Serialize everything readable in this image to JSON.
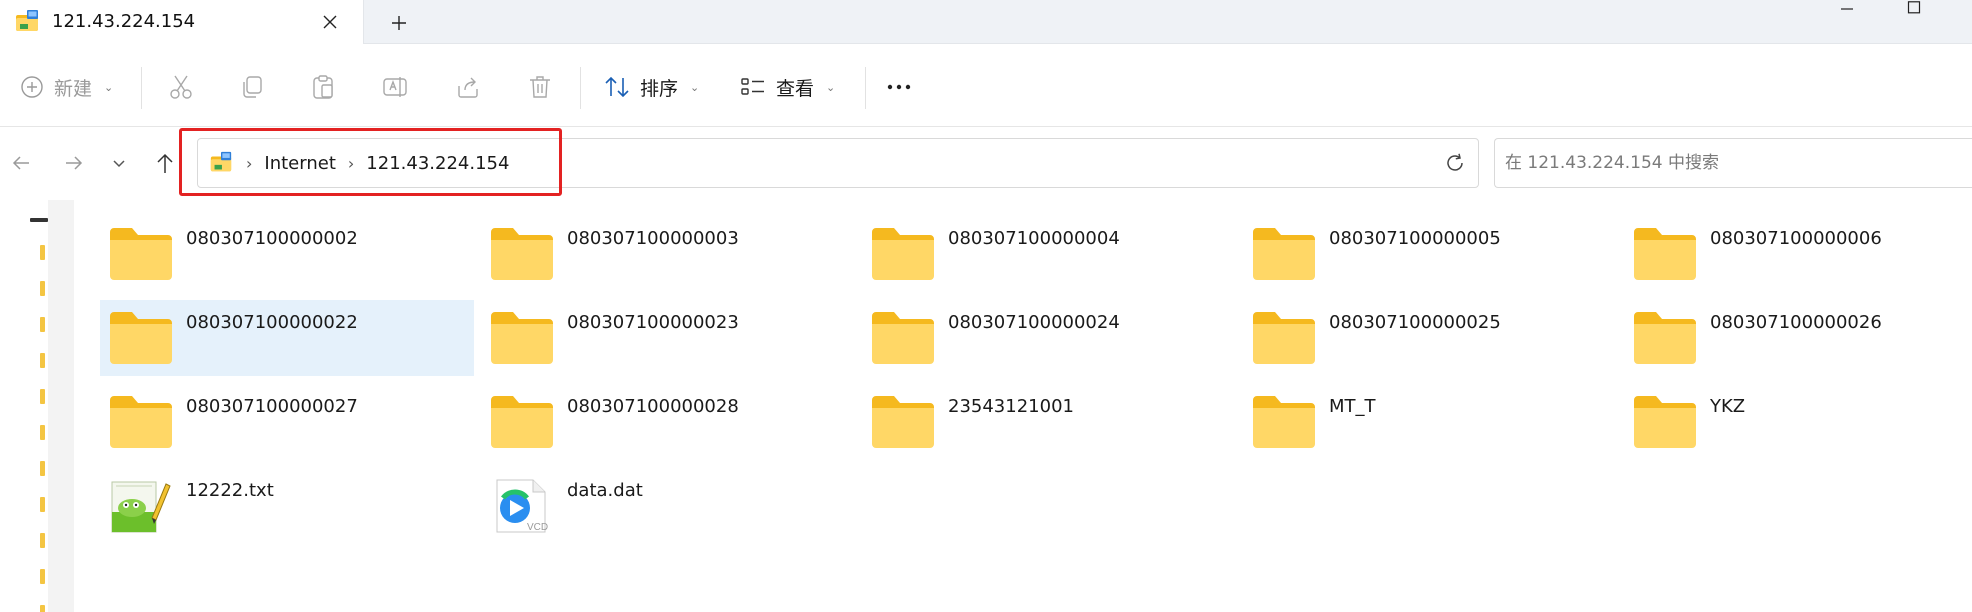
{
  "window": {
    "tab_title": "121.43.224.154",
    "tab_icon": "network-location-icon",
    "close_glyph": "✕",
    "new_tab_glyph": "+"
  },
  "toolbar": {
    "new_label": "新建",
    "sort_label": "排序",
    "view_label": "查看",
    "more_glyph": "•••",
    "disabled_icons": [
      "cut-icon",
      "copy-icon",
      "paste-icon",
      "rename-icon",
      "share-icon",
      "delete-icon"
    ]
  },
  "address": {
    "crumbs": [
      "Internet",
      "121.43.224.154"
    ],
    "separator": "›",
    "highlight_color": "#e32222"
  },
  "search": {
    "placeholder": "在 121.43.224.154 中搜索",
    "value": ""
  },
  "colors": {
    "folder_back": "#f5b91f",
    "folder_front": "#ffd766",
    "selection": "#e5f1fb"
  },
  "items": [
    {
      "name": "080307100000002",
      "type": "folder"
    },
    {
      "name": "080307100000003",
      "type": "folder"
    },
    {
      "name": "080307100000004",
      "type": "folder"
    },
    {
      "name": "080307100000005",
      "type": "folder"
    },
    {
      "name": "080307100000006",
      "type": "folder"
    },
    {
      "name": "080307100000022",
      "type": "folder",
      "selected": true
    },
    {
      "name": "080307100000023",
      "type": "folder"
    },
    {
      "name": "080307100000024",
      "type": "folder"
    },
    {
      "name": "080307100000025",
      "type": "folder"
    },
    {
      "name": "080307100000026",
      "type": "folder"
    },
    {
      "name": "080307100000027",
      "type": "folder"
    },
    {
      "name": "080307100000028",
      "type": "folder"
    },
    {
      "name": "23543121001",
      "type": "folder"
    },
    {
      "name": "MT_T",
      "type": "folder"
    },
    {
      "name": "YKZ",
      "type": "folder"
    },
    {
      "name": "12222.txt",
      "type": "notepad-file"
    },
    {
      "name": "data.dat",
      "type": "video-file",
      "badge": "VCD"
    }
  ]
}
